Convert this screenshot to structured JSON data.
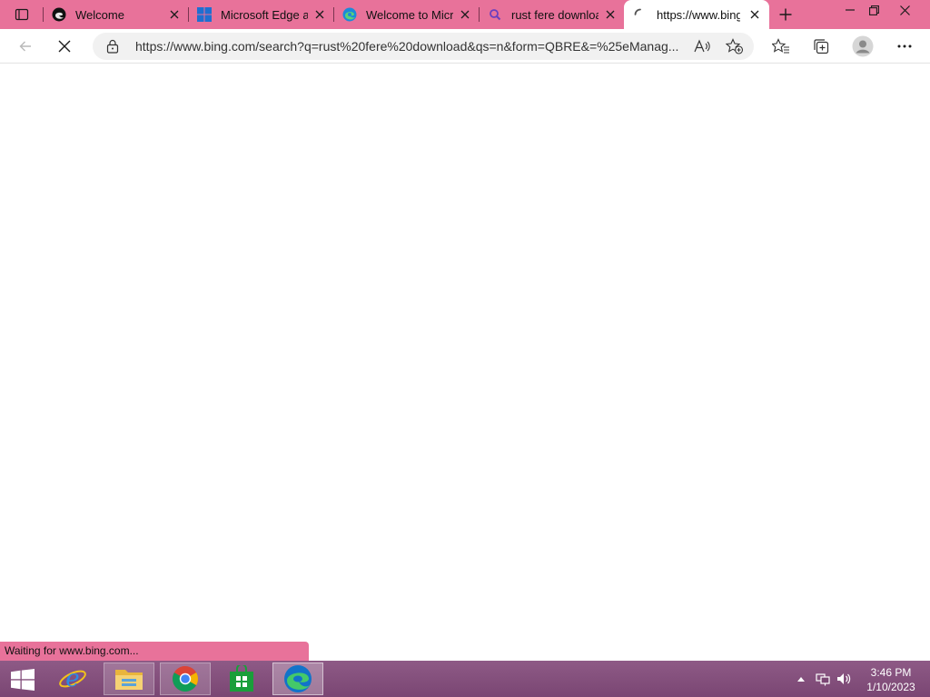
{
  "browser": {
    "tabs": [
      {
        "title": "Welcome",
        "favicon": "edge-dark-icon"
      },
      {
        "title": "Microsoft Edge ar",
        "favicon": "windows-logo-icon"
      },
      {
        "title": "Welcome to Micro",
        "favicon": "edge-icon"
      },
      {
        "title": "rust fere downloa",
        "favicon": "search-icon"
      },
      {
        "title": "https://www.bing",
        "favicon": "loading-spinner-icon",
        "active": true
      }
    ],
    "address_bar": {
      "url": "https://www.bing.com/search?q=rust%20fere%20download&qs=n&form=QBRE&=%25eManag..."
    },
    "status_text": "Waiting for www.bing.com...",
    "accent_color": "#e8729a"
  },
  "taskbar": {
    "apps": [
      {
        "name": "internet-explorer"
      },
      {
        "name": "file-explorer"
      },
      {
        "name": "chrome"
      },
      {
        "name": "store"
      },
      {
        "name": "edge"
      }
    ],
    "clock": {
      "time": "3:46 PM",
      "date": "1/10/2023"
    }
  }
}
